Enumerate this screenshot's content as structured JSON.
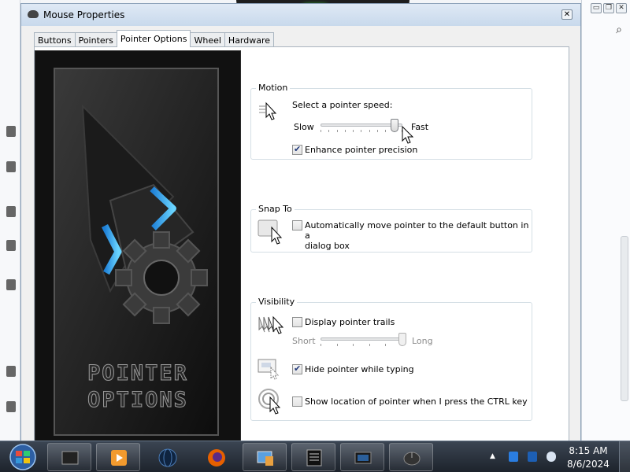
{
  "dialog": {
    "title": "Mouse Properties",
    "close_label": "✕",
    "tabs": [
      {
        "label": "Buttons",
        "active": false
      },
      {
        "label": "Pointers",
        "active": false
      },
      {
        "label": "Pointer Options",
        "active": true
      },
      {
        "label": "Wheel",
        "active": false
      },
      {
        "label": "Hardware",
        "active": false
      }
    ],
    "side_image_text": {
      "line1": "POINTER",
      "line2": "OPTIONS"
    }
  },
  "motion": {
    "title": "Motion",
    "speed_label": "Select a pointer speed:",
    "slow_label": "Slow",
    "fast_label": "Fast",
    "speed_value": 0.9,
    "enhance_precision_label": "Enhance pointer precision",
    "enhance_precision_checked": true
  },
  "snap_to": {
    "title": "Snap To",
    "auto_move_label_line1": "Automatically move pointer to the default button in a",
    "auto_move_label_line2": "dialog box",
    "auto_move_checked": false
  },
  "visibility": {
    "title": "Visibility",
    "trails_label": "Display pointer trails",
    "trails_checked": false,
    "short_label": "Short",
    "long_label": "Long",
    "trails_value": 1.0,
    "hide_typing_label": "Hide pointer while typing",
    "hide_typing_checked": true,
    "ctrl_location_label": "Show location of pointer when I press the CTRL key",
    "ctrl_location_checked": false
  },
  "background_window": {
    "minimize_label": "▭",
    "restore_label": "❐",
    "close_label": "✕",
    "search_icon": "⌕"
  },
  "taskbar": {
    "items": [
      "desktop-gadget",
      "media-player",
      "dark-globe",
      "firefox",
      "control-panel",
      "text-document",
      "display-app",
      "mouse-app"
    ],
    "tray_arrow": "▲",
    "time": "8:15 AM",
    "date": "8/6/2024"
  },
  "colors": {
    "accent": "#3f8ed8",
    "checkmark": "#233a7a",
    "taskbar_top": "#3b4553"
  }
}
